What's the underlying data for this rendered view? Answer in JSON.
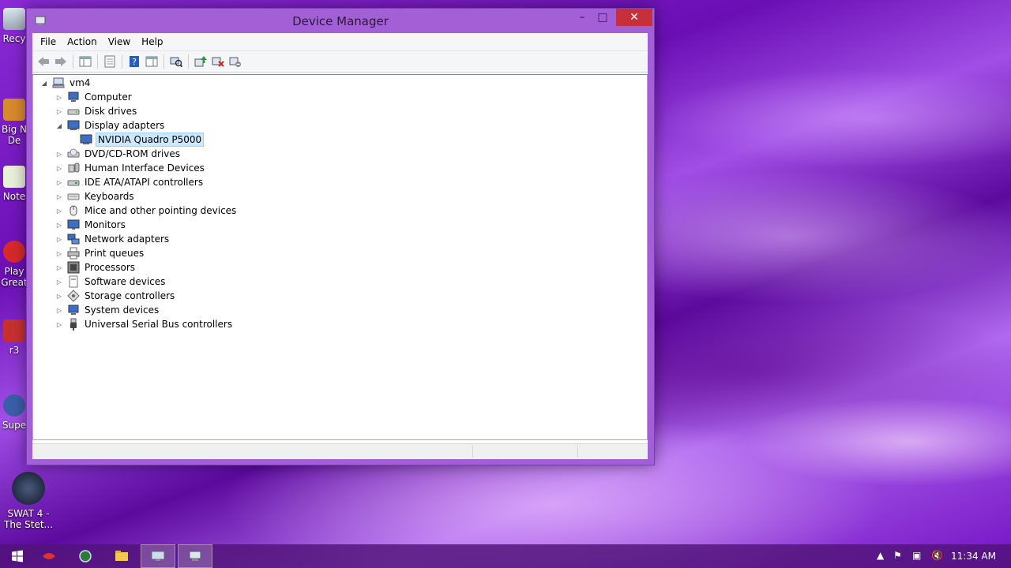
{
  "window": {
    "title": "Device Manager",
    "controls": {
      "minimize": "–",
      "maximize": "□",
      "close": "✕"
    }
  },
  "menu": [
    "File",
    "Action",
    "View",
    "Help"
  ],
  "toolbar_icons": [
    "back-icon",
    "forward-icon",
    "show-hide-console-tree-icon",
    "properties-icon",
    "help-icon",
    "action-pane-icon",
    "scan-hardware-icon",
    "update-driver-icon",
    "uninstall-device-icon",
    "disable-device-icon"
  ],
  "tree": {
    "root": "vm4",
    "nodes": [
      {
        "label": "Computer",
        "icon": "computer-icon",
        "expanded": false
      },
      {
        "label": "Disk drives",
        "icon": "disk-drive-icon",
        "expanded": false
      },
      {
        "label": "Display adapters",
        "icon": "display-adapter-icon",
        "expanded": true,
        "children": [
          "NVIDIA Quadro P5000"
        ]
      },
      {
        "label": "DVD/CD-ROM drives",
        "icon": "dvd-drive-icon",
        "expanded": false
      },
      {
        "label": "Human Interface Devices",
        "icon": "hid-icon",
        "expanded": false
      },
      {
        "label": "IDE ATA/ATAPI controllers",
        "icon": "ide-controller-icon",
        "expanded": false
      },
      {
        "label": "Keyboards",
        "icon": "keyboard-icon",
        "expanded": false
      },
      {
        "label": "Mice and other pointing devices",
        "icon": "mouse-icon",
        "expanded": false
      },
      {
        "label": "Monitors",
        "icon": "monitor-icon",
        "expanded": false
      },
      {
        "label": "Network adapters",
        "icon": "network-adapter-icon",
        "expanded": false
      },
      {
        "label": "Print queues",
        "icon": "printer-icon",
        "expanded": false
      },
      {
        "label": "Processors",
        "icon": "processor-icon",
        "expanded": false
      },
      {
        "label": "Software devices",
        "icon": "software-device-icon",
        "expanded": false
      },
      {
        "label": "Storage controllers",
        "icon": "storage-controller-icon",
        "expanded": false
      },
      {
        "label": "System devices",
        "icon": "system-device-icon",
        "expanded": false
      },
      {
        "label": "Universal Serial Bus controllers",
        "icon": "usb-icon",
        "expanded": false
      }
    ],
    "selected": "NVIDIA Quadro P5000"
  },
  "desktop_icons": [
    {
      "label": "Recy",
      "icon": "recycle-bin-icon"
    },
    {
      "label": "Big N\nDe",
      "icon": "shortcut-icon"
    },
    {
      "label": "Note",
      "icon": "notepad-icon"
    },
    {
      "label": "Play\nGreat",
      "icon": "game-shortcut-icon"
    },
    {
      "label": "r3",
      "icon": "shortcut-icon"
    },
    {
      "label": "Supe",
      "icon": "shortcut-icon"
    },
    {
      "label": "SWAT 4 -\nThe Stet...",
      "icon": "swat4-icon"
    }
  ],
  "taskbar": {
    "clock": "11:34 AM",
    "buttons": [
      "start-icon",
      "game-app-icon",
      "globe-app-icon",
      "file-explorer-icon",
      "remote-app-icon",
      "device-manager-icon"
    ],
    "tray": [
      "show-hidden-icons-icon",
      "action-center-flag-icon",
      "network-icon",
      "volume-muted-icon"
    ]
  },
  "colors": {
    "selection": "#cce8ff",
    "close_button": "#c7303a",
    "window_frame": "#a35fd6"
  }
}
